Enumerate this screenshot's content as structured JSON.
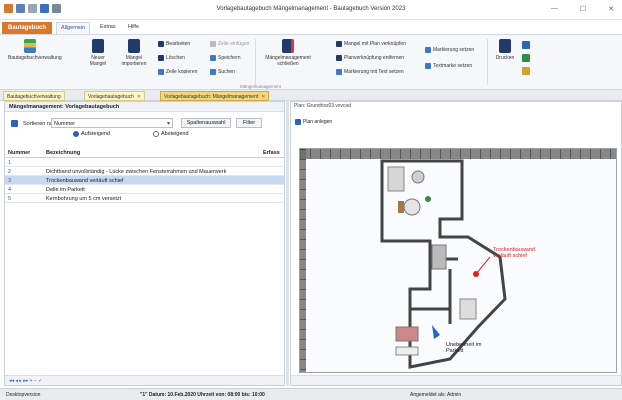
{
  "window": {
    "title": "Vorlagebautagebuch Mängelmanagement - Bautagebuch Version 2023",
    "min": "—",
    "max": "☐",
    "close": "✕"
  },
  "ribbon_tabs": {
    "file": "Bautagebuch",
    "tabs": [
      "Allgemein",
      "Extras",
      "Hilfe"
    ]
  },
  "ribbon": {
    "bautagebuchverwaltung": "Bautagebuchverwaltung",
    "neuer_mangel": "Neuer Mangel",
    "maengel_importieren": "Mängel importieren",
    "bearbeiten": "Bearbeiten",
    "loeschen": "Löschen",
    "zeile_kopieren": "Zeile kopieren",
    "zeile_einfuegen": "Zeile einfügen",
    "speichern": "Speichern",
    "suchen": "Suchen",
    "maengelmanagement_schliessen": "Mängelmanagement schließen",
    "mangel_verknuepfen": "Mangel mit Plan verknüpfen",
    "planverknuepfung_entfernen": "Planverknüpfung entfernen",
    "markierung_mit_text": "Markierung mit Text setzen",
    "markierung_setzen": "Markierung setzen",
    "textmarke_setzen": "Textmarke setzen",
    "drucken": "Drucken",
    "group_label": "Mängelmanagement"
  },
  "doc_tabs": [
    "Bautagebuchverwaltung",
    "Vorlagebautagebuch",
    "Vorlagebautagebuch: Mängelmanagement"
  ],
  "left": {
    "title": "Mängelmanagement: Vorlagebautagebuch",
    "sort_label": "Sortieren nach:",
    "sort_value": "Nummer",
    "spalten_btn": "Spaltenauswahl",
    "filter_btn": "Filter",
    "asc": "Aufsteigend",
    "desc": "Absteigend",
    "col_nummer": "Nummer",
    "col_bezeichnung": "Bezeichnung",
    "col_erfasst": "Erfass",
    "rows": [
      {
        "nr": "1",
        "bez": ""
      },
      {
        "nr": "2",
        "bez": "Dichtband unvollständig - Lücke zwischen Fensterrahmen und Mauerwerk"
      },
      {
        "nr": "3",
        "bez": "Trockenbauwand verläuft schief"
      },
      {
        "nr": "4",
        "bez": "Delle im Parkett"
      },
      {
        "nr": "5",
        "bez": "Kernbohrung um 5 cm versetzt"
      }
    ],
    "nav": "◂◂ ◂ ▸ ▸▸ + − ✓"
  },
  "right": {
    "plan_title": "Plan: Grundriss03.vsvcad",
    "plan_anlegen": "Plan anlegen",
    "annotation1": "Trockenbauwand verläuft schief",
    "annotation2": "Unebenheit im Parkett"
  },
  "status": {
    "left": "Desktopversion",
    "datum": "\"1\" Datum: 10.Feb.2020 Uhrzeit von: 08:00 bis: 10:00",
    "user": "Angemeldet als: Admin"
  },
  "colors": {
    "accent": "#d9782b",
    "selection": "#c7d9f1",
    "annotation": "#e02020"
  }
}
